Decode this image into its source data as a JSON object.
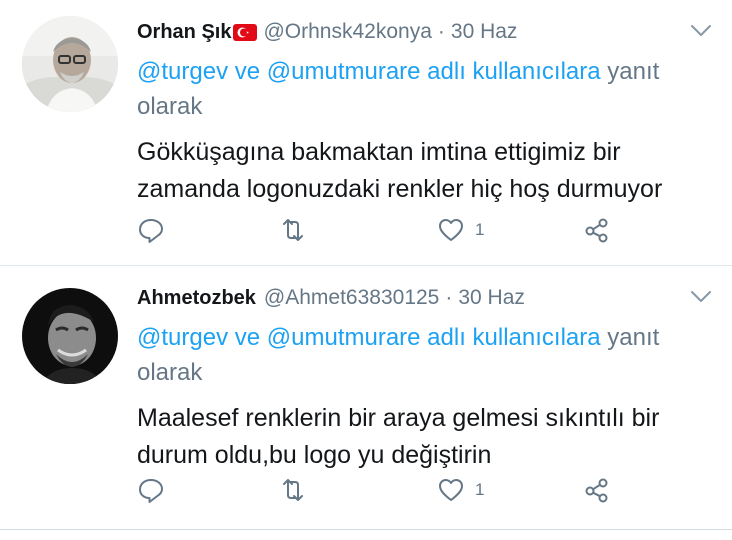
{
  "tweets": [
    {
      "name": "Orhan Şık",
      "handle": "@Orhnsk42konya",
      "sep": "·",
      "date": "30 Haz",
      "mention1": "@turgev",
      "connector": " ve ",
      "mention2": "@umutmurare",
      "mention2_suffix": " adlı kullanıcılara",
      "reply_suffix": " yanıt olarak",
      "text": "Gökküşagına bakmaktan imtina ettigimiz bir zamanda logonuzdaki renkler hiç hoş durmuyor",
      "like_count": "1",
      "has_flag": true,
      "avatar": "man-glasses-photo"
    },
    {
      "name": "Ahmetozbek",
      "handle": "@Ahmet63830125",
      "sep": "·",
      "date": "30 Haz",
      "mention1": "@turgev",
      "connector": " ve ",
      "mention2": "@umutmurare",
      "mention2_suffix": " adlı kullanıcılara",
      "reply_suffix": " yanıt olarak",
      "text": "Maalesef renklerin bir araya gelmesi sıkıntılı bir durum oldu,bu logo yu değiştirin",
      "like_count": "1",
      "has_flag": false,
      "avatar": "man-bw-photo"
    }
  ],
  "icons": {
    "reply": "reply-icon",
    "retweet": "retweet-icon",
    "like": "heart-icon",
    "share": "share-icon",
    "caret": "chevron-down-icon",
    "flag": "turkish-flag-icon"
  },
  "colors": {
    "link": "#1da1f2",
    "secondary": "#657786",
    "text": "#14171a",
    "divider": "#e1e8ed"
  }
}
